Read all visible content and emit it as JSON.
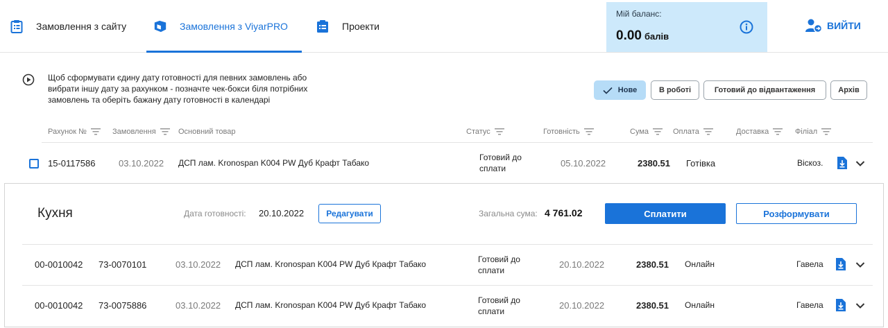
{
  "nav": {
    "tabs": [
      {
        "label": "Замовлення з сайту",
        "icon": "clipboard-icon"
      },
      {
        "label": "Замовлення з ViyarPRO",
        "icon": "cube-icon",
        "active": true
      },
      {
        "label": "Проекти",
        "icon": "list-icon"
      }
    ],
    "balance_label": "Мій баланс:",
    "balance_value": "0.00",
    "balance_unit": "балів",
    "logout_label": "ВИЙТИ"
  },
  "hint": "Щоб сформувати єдину дату готовності для певних замовлень або вибрати іншу дату за рахунком - позначте чек-бокси біля потрібних замовлень та оберіть бажану дату готовності в календарі",
  "filters": {
    "new": "Нове",
    "in_work": "В роботі",
    "ready": "Готовий до відвантаження",
    "archive": "Архів"
  },
  "columns": {
    "invoice": "Рахунок №",
    "order": "Замовлення",
    "product": "Основний товар",
    "status": "Статус",
    "readiness": "Готовність",
    "sum": "Сума",
    "payment": "Оплата",
    "delivery": "Доставка",
    "branch": "Філіал"
  },
  "row1": {
    "invoice": "15-0117586",
    "order_date": "03.10.2022",
    "product": "ДСП лам. Kronospan K004 PW Дуб Крафт Табако",
    "status": "Готовий до сплати",
    "readiness": "05.10.2022",
    "sum": "2380.51",
    "payment": "Готівка",
    "branch": "Віскоз."
  },
  "group": {
    "name": "Кухня",
    "date_label": "Дата готовності:",
    "date_value": "20.10.2022",
    "edit_label": "Редагувати",
    "sum_label": "Загальна сума:",
    "sum_value": "4 761.02",
    "pay_label": "Сплатити",
    "unform_label": "Розформувати",
    "rows": [
      {
        "invoice": "00-0010042",
        "order": "73-0070101",
        "order_date": "03.10.2022",
        "product": "ДСП лам. Kronospan K004 PW Дуб Крафт Табако",
        "status": "Готовий до сплати",
        "readiness": "20.10.2022",
        "sum": "2380.51",
        "payment": "Онлайн",
        "branch": "Гавела"
      },
      {
        "invoice": "00-0010042",
        "order": "73-0075886",
        "order_date": "03.10.2022",
        "product": "ДСП лам. Kronospan K004 PW Дуб Крафт Табако",
        "status": "Готовий до сплати",
        "readiness": "20.10.2022",
        "sum": "2380.51",
        "payment": "Онлайн",
        "branch": "Гавела"
      }
    ]
  },
  "colors": {
    "accent": "#1a73d9",
    "balance_bg": "#cde9fb",
    "filter_active_bg": "#b6dcf7"
  }
}
